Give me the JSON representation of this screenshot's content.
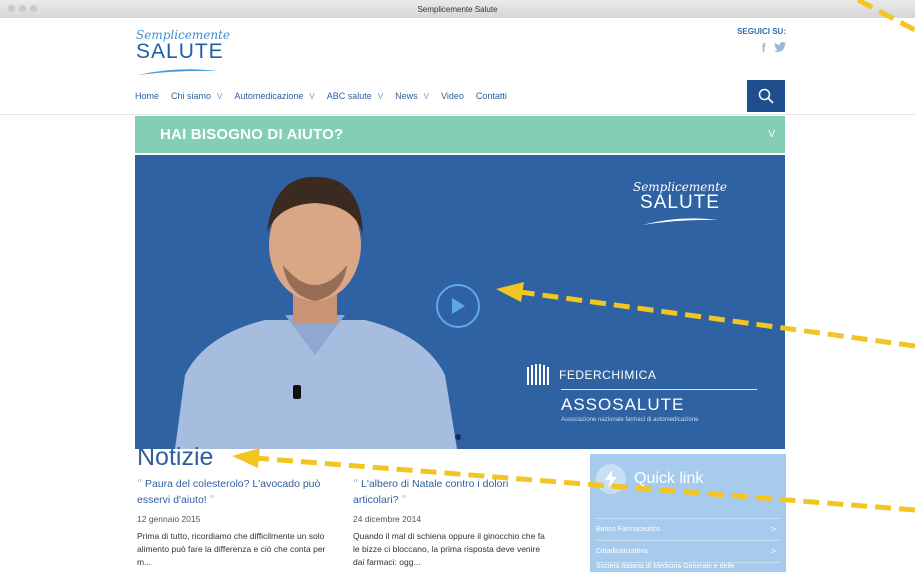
{
  "window": {
    "title": "Semplicemente Salute"
  },
  "logo": {
    "script": "Semplicemente",
    "main": "SALUTE"
  },
  "social": {
    "label": "SEGUICI SU:",
    "icons": [
      "facebook-icon",
      "twitter-icon"
    ],
    "facebook_glyph": "f",
    "twitter_glyph": "🐦"
  },
  "nav": {
    "items": [
      {
        "label": "Home"
      },
      {
        "label": "Chi siamo",
        "dropdown": true
      },
      {
        "label": "Automedicazione",
        "dropdown": true
      },
      {
        "label": "ABC salute",
        "dropdown": true
      },
      {
        "label": "News",
        "dropdown": true
      },
      {
        "label": "Video"
      },
      {
        "label": "Contatti"
      }
    ],
    "chevron": "V",
    "search_icon": "search-icon"
  },
  "help_bar": {
    "text": "HAI BISOGNO DI AIUTO?",
    "chevron": "V"
  },
  "hero": {
    "logo_script": "Semplicemente",
    "logo_main": "SALUTE",
    "partner": "FEDERCHIMICA",
    "brand": "ASSOSALUTE",
    "brand_sub": "Associazione nazionale farmaci di automedicazione",
    "play_icon": "play-icon"
  },
  "news": {
    "heading": "Notizie",
    "quote_open": "\"",
    "quote_close": "\"",
    "items": [
      {
        "title": "Paura del colesterolo? L'avocado può esservi d'aiuto!",
        "date": "12 gennaio 2015",
        "excerpt": "Prima di tutto, ricordiamo che difficilmente un solo alimento può fare la differenza e ciò che conta per m..."
      },
      {
        "title": "L'albero di Natale contro i dolori articolari?",
        "date": "24 dicembre 2014",
        "excerpt": "Quando il mal di schiena oppure il ginocchio che fa le bizze ci bloccano, la prima risposta deve venire dai farmaci: ogg..."
      }
    ]
  },
  "quick_links": {
    "title": "Quick link",
    "icon": "lightning-icon",
    "arrow": ">",
    "items": [
      {
        "label": "Banco Farmaceutico"
      },
      {
        "label": "Cittadinanzattiva"
      },
      {
        "label": "Società Italiana di Medicina Generale e delle"
      }
    ]
  },
  "colors": {
    "nav_text": "#2f5fa0",
    "help_bar": "#84cdb6",
    "hero_bg": "#2f62a2",
    "search_bg": "#1f4e8c",
    "quick_bg": "#a7cbec",
    "annotation_arrow": "#f3c522"
  }
}
